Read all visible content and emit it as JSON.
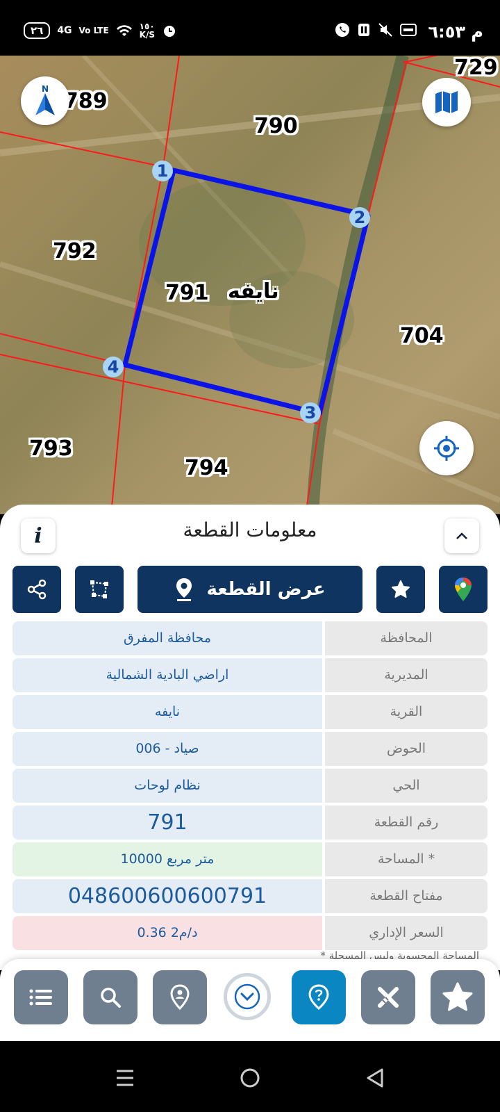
{
  "status_bar": {
    "time": "٦:٥٣",
    "ampm": "م",
    "battery": "٢٦",
    "network": "4G",
    "volte": "Vo LTE",
    "speed": "١٥٠",
    "speed_unit": "K/S"
  },
  "map": {
    "parcel_labels": {
      "p789": "789",
      "p790": "790",
      "p729": "729",
      "p792": "792",
      "p791": "791",
      "p704": "704",
      "p793": "793",
      "p794": "794"
    },
    "village_label": "نايفه",
    "vertices": [
      "1",
      "2",
      "3",
      "4"
    ],
    "compass_letter": "N"
  },
  "panel": {
    "title": "معلومات القطعة",
    "show_parcel_label": "عرض القطعة",
    "rows": [
      {
        "label": "المحافظة",
        "value": "محافظة المفرق"
      },
      {
        "label": "المديرية",
        "value": "اراضي البادية الشمالية"
      },
      {
        "label": "القرية",
        "value": "نايفه"
      },
      {
        "label": "الحوض",
        "value": "صياد - 006"
      },
      {
        "label": "الحي",
        "value": "نظام لوحات"
      },
      {
        "label": "رقم القطعة",
        "value": "791"
      },
      {
        "label": "المساحة *",
        "value": "10000  متر مربع"
      },
      {
        "label": "مفتاح القطعة",
        "value": "048600600600791"
      },
      {
        "label": "السعر الإداري",
        "value": "0.36 د/م2"
      }
    ],
    "footnote": "* المساحة المحسوبة وليس المسجلة"
  },
  "colors": {
    "primary": "#0f3460",
    "active": "#0a86c2",
    "parcel_outline": "#0a14e6",
    "boundary": "#ff1a1a"
  }
}
